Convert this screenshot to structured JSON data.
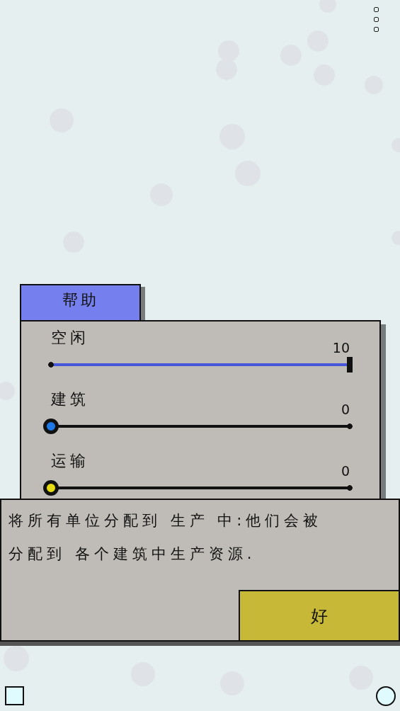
{
  "menu": {
    "label": "帮助"
  },
  "sliders": [
    {
      "label": "空闲",
      "reading": "10",
      "level": 1
    },
    {
      "label": "建筑",
      "reading": "0",
      "level": 0,
      "color": "#1e78e6"
    },
    {
      "label": "运输",
      "reading": "0",
      "level": 0,
      "color": "#e6dc14"
    }
  ],
  "message": {
    "lines": [
      "将所有单位分配到 生产 中:他们会被",
      "分配到 各个建筑中生产资源."
    ],
    "button": "好"
  }
}
